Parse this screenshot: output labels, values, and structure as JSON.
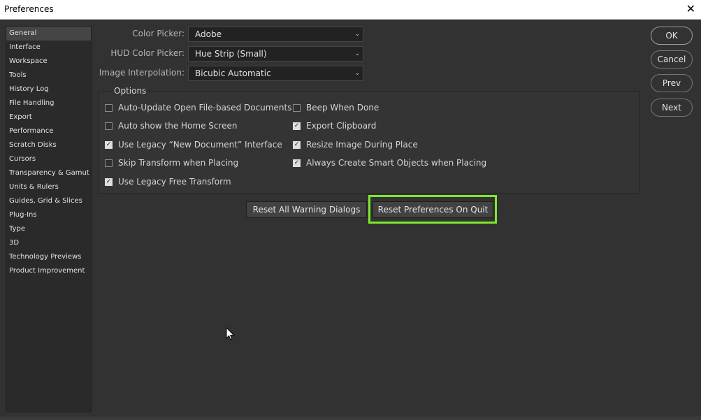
{
  "window": {
    "title": "Preferences",
    "close_glyph": "✕"
  },
  "sidebar": {
    "items": [
      {
        "label": "General",
        "active": true
      },
      {
        "label": "Interface"
      },
      {
        "label": "Workspace"
      },
      {
        "label": "Tools"
      },
      {
        "label": "History Log"
      },
      {
        "label": "File Handling"
      },
      {
        "label": "Export"
      },
      {
        "label": "Performance"
      },
      {
        "label": "Scratch Disks"
      },
      {
        "label": "Cursors"
      },
      {
        "label": "Transparency & Gamut"
      },
      {
        "label": "Units & Rulers"
      },
      {
        "label": "Guides, Grid & Slices"
      },
      {
        "label": "Plug-Ins"
      },
      {
        "label": "Type"
      },
      {
        "label": "3D"
      },
      {
        "label": "Technology Previews"
      },
      {
        "label": "Product Improvement"
      }
    ]
  },
  "settings": {
    "color_picker": {
      "label": "Color Picker:",
      "value": "Adobe"
    },
    "hud_color_picker": {
      "label": "HUD Color Picker:",
      "value": "Hue Strip (Small)"
    },
    "image_interpolation": {
      "label": "Image Interpolation:",
      "value": "Bicubic Automatic"
    }
  },
  "options": {
    "title": "Options",
    "left": [
      {
        "label": "Auto-Update Open File-based Documents",
        "checked": false
      },
      {
        "label": "Auto show the Home Screen",
        "checked": false
      },
      {
        "label": "Use Legacy “New Document” Interface",
        "checked": true
      },
      {
        "label": "Skip Transform when Placing",
        "checked": false
      },
      {
        "label": "Use Legacy Free Transform",
        "checked": true
      }
    ],
    "right": [
      {
        "label": "Beep When Done",
        "checked": false
      },
      {
        "label": "Export Clipboard",
        "checked": true
      },
      {
        "label": "Resize Image During Place",
        "checked": true
      },
      {
        "label": "Always Create Smart Objects when Placing",
        "checked": true
      }
    ]
  },
  "actions": {
    "reset_warnings": "Reset All Warning Dialogs",
    "reset_prefs": "Reset Preferences On Quit"
  },
  "buttons": {
    "ok": "OK",
    "cancel": "Cancel",
    "prev": "Prev",
    "next": "Next"
  },
  "colors": {
    "highlight": "#7fe82b",
    "panel": "#323232"
  }
}
